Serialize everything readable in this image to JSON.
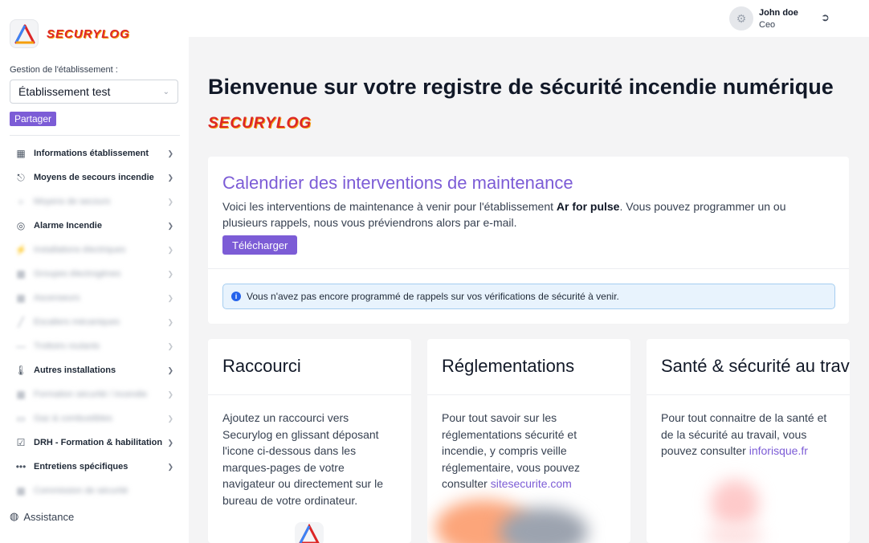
{
  "sidebar": {
    "brand": "SECURYLOG",
    "gestion_label": "Gestion de l'établissement :",
    "etablissement": "Établissement test",
    "share_label": "Partager",
    "items": [
      {
        "label": "Informations établissement",
        "icon": "building-icon"
      },
      {
        "label": "Moyens de secours incendie",
        "icon": "extinguisher-icon"
      },
      {
        "label": "Moyens de secours",
        "icon": "hose-icon"
      },
      {
        "label": "Alarme Incendie",
        "icon": "alarm-icon"
      },
      {
        "label": "Installations électriques",
        "icon": "bolt-icon"
      },
      {
        "label": "Groupes électrogènes",
        "icon": "generator-icon"
      },
      {
        "label": "Ascenseurs",
        "icon": "elevator-icon"
      },
      {
        "label": "Escaliers mécaniques",
        "icon": "escalator-icon"
      },
      {
        "label": "Trottoirs roulants",
        "icon": "walkway-icon"
      },
      {
        "label": "Autres installations",
        "icon": "thermometer-icon"
      },
      {
        "label": "Formation sécurité / incendie",
        "icon": "training-icon"
      },
      {
        "label": "Gaz & combustibles",
        "icon": "gas-icon"
      },
      {
        "label": "DRH - Formation & habilitation",
        "icon": "clipboard-icon"
      },
      {
        "label": "Entretiens spécifiques",
        "icon": "dots-icon"
      },
      {
        "label": "Commission de sécurité",
        "icon": "commission-icon"
      }
    ],
    "assist_label": "Assistance"
  },
  "topbar": {
    "user_name": "John doe",
    "user_role": "Ceo"
  },
  "main": {
    "title": "Bienvenue sur votre registre de sécurité incendie numérique",
    "brand": "SECURYLOG",
    "calendar": {
      "title": "Calendrier des interventions de maintenance",
      "text_before": "Voici les interventions de maintenance à venir pour l'établissement ",
      "etab_name": "Ar for pulse",
      "text_after": ". Vous pouvez programmer un ou plusieurs rappels, nous vous préviendrons alors par e-mail.",
      "download_label": "Télécharger",
      "alert": "Vous n'avez pas encore programmé de rappels sur vos vérifications de sécurité à venir."
    },
    "cards": [
      {
        "title": "Raccourci",
        "text": "Ajoutez un raccourci vers Securylog en glissant déposant l'icone ci-dessous dans les marques-pages de votre navigateur ou directement sur le bureau de votre ordinateur."
      },
      {
        "title": "Réglementations",
        "text": "Pour tout savoir sur les réglementations sécurité et incendie, y compris veille réglementaire, vous pouvez consulter ",
        "link": "sitesecurite.com"
      },
      {
        "title": "Santé & sécurité au travail",
        "text": "Pour tout connaitre de la santé et de la sécurité au travail, vous pouvez consulter ",
        "link": "inforisque.fr"
      }
    ]
  },
  "colors": {
    "accent": "#7c5cd6",
    "brand_red": "#dc2626",
    "info_blue": "#2563eb"
  }
}
